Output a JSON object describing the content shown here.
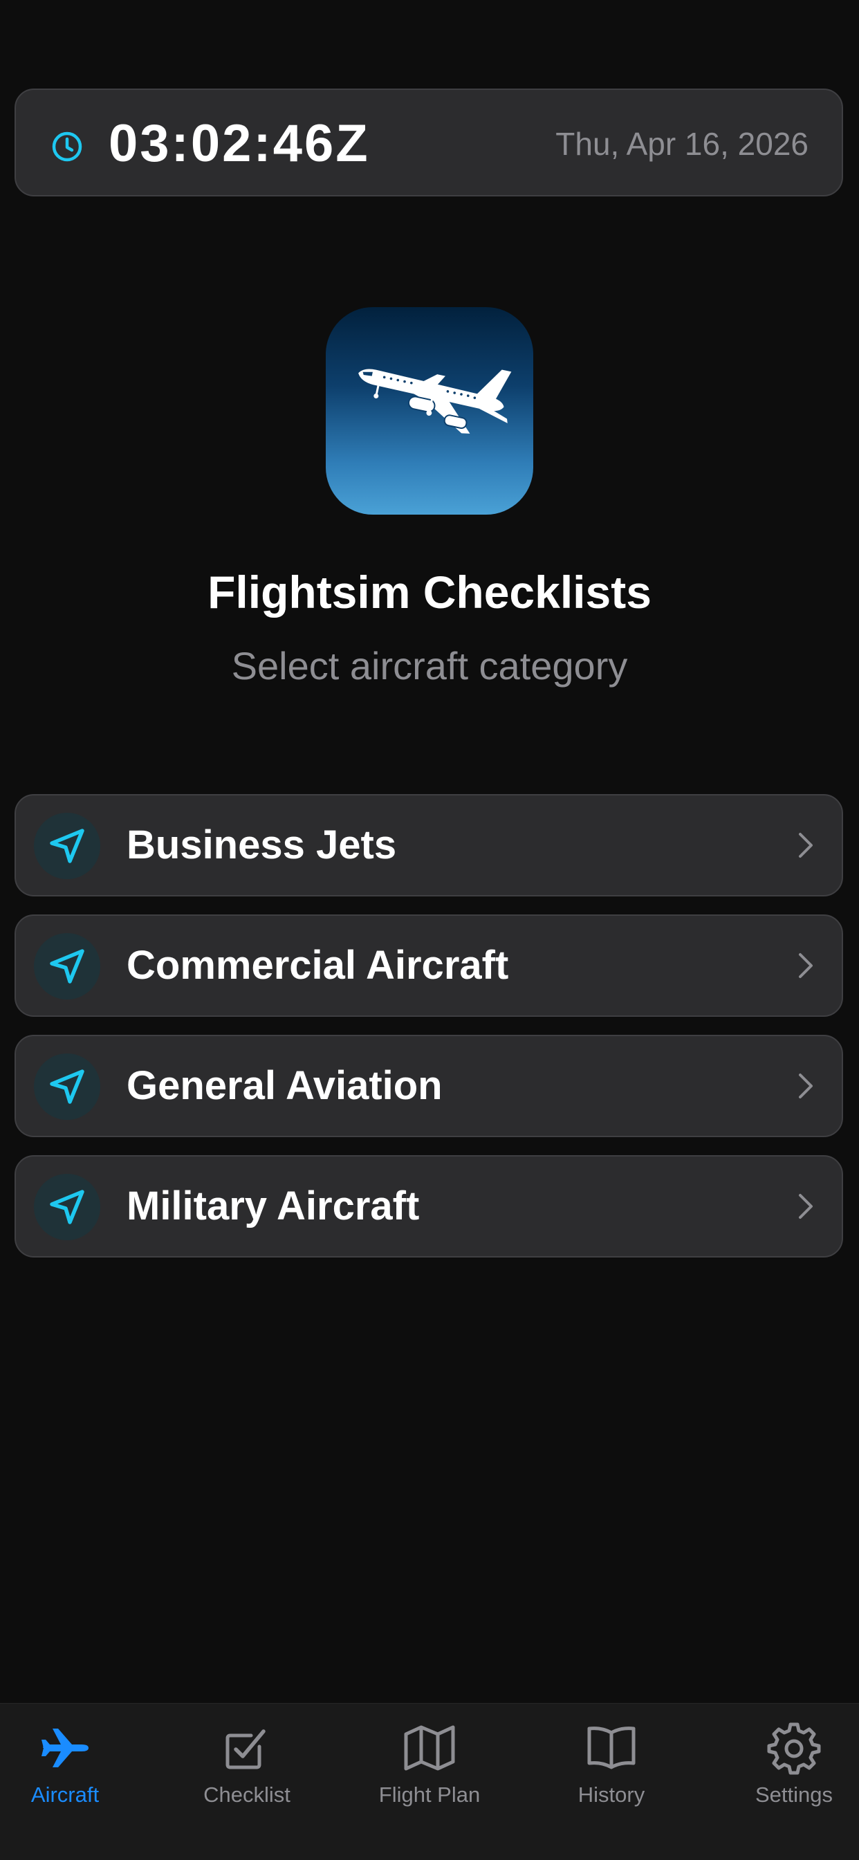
{
  "clock": {
    "time": "03:02:46Z",
    "date": "Thu, Apr 16, 2026",
    "icon": "clock-icon"
  },
  "app": {
    "icon": "airplane-logo",
    "title": "Flightsim Checklists",
    "subtitle": "Select aircraft category"
  },
  "categories": [
    {
      "label": "Business Jets",
      "icon": "navigation-arrow-icon"
    },
    {
      "label": "Commercial Aircraft",
      "icon": "navigation-arrow-icon"
    },
    {
      "label": "General Aviation",
      "icon": "navigation-arrow-icon"
    },
    {
      "label": "Military Aircraft",
      "icon": "navigation-arrow-icon"
    }
  ],
  "tabs": [
    {
      "label": "Aircraft",
      "icon": "airplane-icon",
      "active": true
    },
    {
      "label": "Checklist",
      "icon": "checkbox-icon",
      "active": false
    },
    {
      "label": "Flight Plan",
      "icon": "map-icon",
      "active": false
    },
    {
      "label": "History",
      "icon": "book-icon",
      "active": false
    },
    {
      "label": "Settings",
      "icon": "gear-icon",
      "active": false
    }
  ],
  "colors": {
    "background": "#0d0d0d",
    "card": "#2c2c2e",
    "accent_cyan": "#1ec8f0",
    "tab_active": "#1a8cff",
    "secondary_text": "#8e8e93"
  }
}
